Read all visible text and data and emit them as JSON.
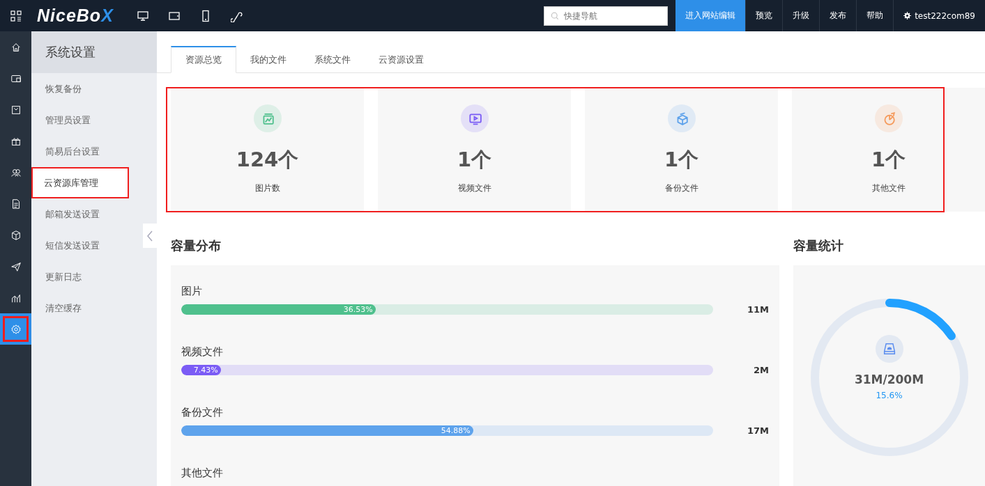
{
  "topbar": {
    "logo": {
      "text": "NiceBo",
      "accent": "X"
    },
    "search": {
      "placeholder": "快捷导航"
    },
    "buttons": [
      {
        "label": "进入网站编辑",
        "selected": true
      },
      {
        "label": "预览",
        "selected": false
      },
      {
        "label": "升级",
        "selected": false
      },
      {
        "label": "发布",
        "selected": false
      },
      {
        "label": "帮助",
        "selected": false
      }
    ],
    "user": "test222com89"
  },
  "rail": [
    {
      "selected": false,
      "highlighted": false
    },
    {
      "selected": false,
      "highlighted": false
    },
    {
      "selected": false,
      "highlighted": false
    },
    {
      "selected": false,
      "highlighted": false
    },
    {
      "selected": false,
      "highlighted": false
    },
    {
      "selected": false,
      "highlighted": false
    },
    {
      "selected": false,
      "highlighted": false
    },
    {
      "selected": false,
      "highlighted": false
    },
    {
      "selected": false,
      "highlighted": false
    },
    {
      "selected": true,
      "highlighted": true
    }
  ],
  "sidebar": {
    "title": "系统设置",
    "items": [
      {
        "label": "恢复备份",
        "selected": false,
        "highlighted": false
      },
      {
        "label": "管理员设置",
        "selected": false,
        "highlighted": false
      },
      {
        "label": "简易后台设置",
        "selected": false,
        "highlighted": false
      },
      {
        "label": "云资源库管理",
        "selected": true,
        "highlighted": true
      },
      {
        "label": "邮箱发送设置",
        "selected": false,
        "highlighted": false
      },
      {
        "label": "短信发送设置",
        "selected": false,
        "highlighted": false
      },
      {
        "label": "更新日志",
        "selected": false,
        "highlighted": false
      },
      {
        "label": "清空缓存",
        "selected": false,
        "highlighted": false
      }
    ]
  },
  "tabs": [
    {
      "label": "资源总览",
      "selected": true
    },
    {
      "label": "我的文件",
      "selected": false
    },
    {
      "label": "系统文件",
      "selected": false
    },
    {
      "label": "云资源设置",
      "selected": false
    }
  ],
  "stats_highlighted": true,
  "stats": [
    {
      "value": "124个",
      "label": "图片数",
      "color": "#4fc08d"
    },
    {
      "value": "1个",
      "label": "视频文件",
      "color": "#7b5cf5"
    },
    {
      "value": "1个",
      "label": "备份文件",
      "color": "#5ea3ec"
    },
    {
      "value": "1个",
      "label": "其他文件",
      "color": "#f59a5b"
    }
  ],
  "distribution": {
    "title": "容量分布",
    "items": [
      {
        "label": "图片",
        "level": 0.3653,
        "percent": "36.53%",
        "size": "11M",
        "color": "#4fc08d"
      },
      {
        "label": "视频文件",
        "level": 0.0743,
        "percent": "7.43%",
        "size": "2M",
        "color": "#7b5cf5"
      },
      {
        "label": "备份文件",
        "level": 0.5488,
        "percent": "54.88%",
        "size": "17M",
        "color": "#5ea3ec"
      },
      {
        "label": "其他文件"
      }
    ]
  },
  "usage": {
    "title": "容量统计",
    "amount": "31M/200M",
    "percent": "15.6%",
    "level": 0.156
  }
}
